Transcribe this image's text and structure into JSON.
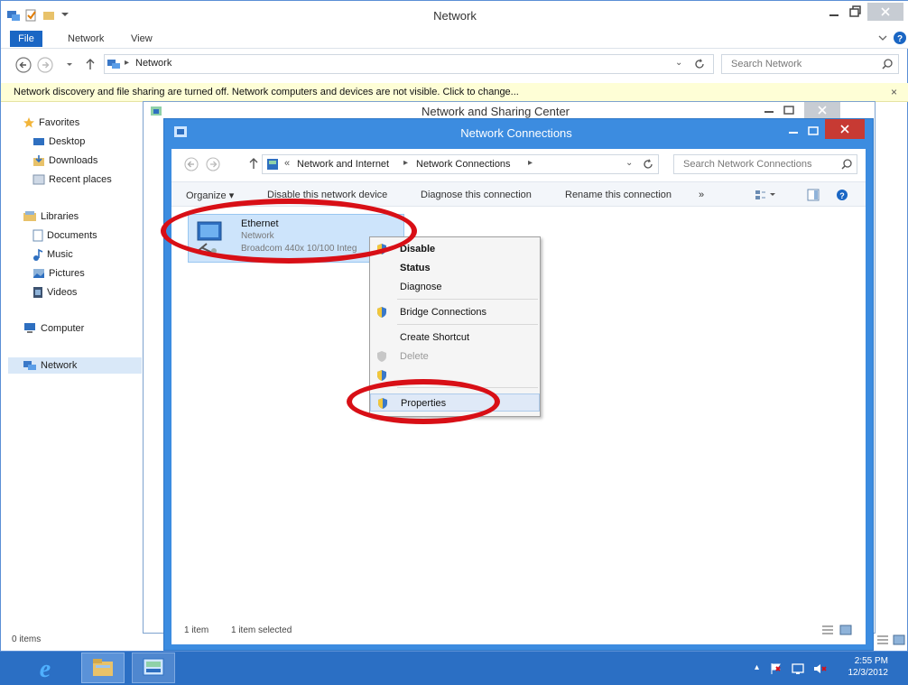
{
  "outer": {
    "title": "Network",
    "ribbon_tabs": [
      "File",
      "Network",
      "View"
    ],
    "address_crumb": "Network",
    "search_placeholder": "Search Network",
    "infobar": "Network discovery and file sharing are turned off. Network computers and devices are not visible. Click to change...",
    "nav": {
      "favorites": "Favorites",
      "desktop": "Desktop",
      "downloads": "Downloads",
      "recent": "Recent places",
      "libraries": "Libraries",
      "documents": "Documents",
      "music": "Music",
      "pictures": "Pictures",
      "videos": "Videos",
      "computer": "Computer",
      "network": "Network"
    },
    "status": "0 items"
  },
  "nsc": {
    "title": "Network and Sharing Center"
  },
  "nc": {
    "title": "Network Connections",
    "breadcrumb": [
      "Network and Internet",
      "Network Connections"
    ],
    "search_placeholder": "Search Network Connections",
    "toolbar": {
      "organize": "Organize",
      "disable": "Disable this network device",
      "diagnose": "Diagnose this connection",
      "rename": "Rename this connection",
      "more": "»"
    },
    "item": {
      "name": "Ethernet",
      "status": "Network",
      "device": "Broadcom 440x 10/100 Integ"
    },
    "status_count": "1 item",
    "status_selected": "1 item selected"
  },
  "menu": {
    "disable": "Disable",
    "status": "Status",
    "diagnose": "Diagnose",
    "bridge": "Bridge Connections",
    "shortcut": "Create Shortcut",
    "delete": "Delete",
    "properties": "Properties"
  },
  "taskbar": {
    "time": "2:55 PM",
    "date": "12/3/2012"
  },
  "colors": {
    "accent": "#3c8ce0",
    "annotation": "#d80f16",
    "taskbar": "#2b6fc4"
  }
}
